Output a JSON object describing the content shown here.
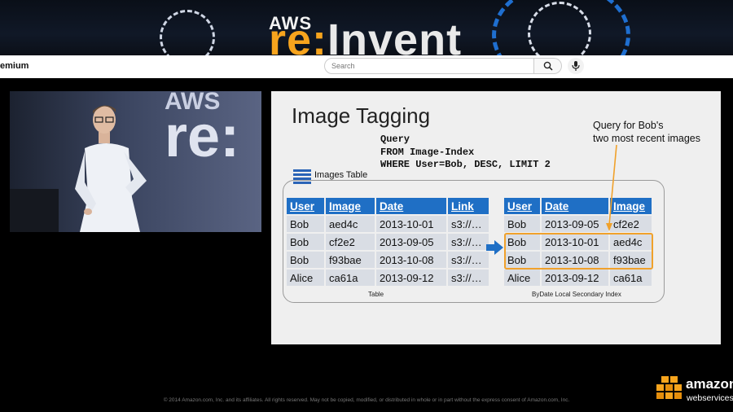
{
  "banner": {
    "brand_aws": "AWS",
    "brand_re": "re:",
    "brand_invent": "Invent",
    "accent": "#f7a41d"
  },
  "youtube": {
    "premium_label": "emium",
    "search_placeholder": "Search",
    "search_icon": "search-icon",
    "mic_icon": "mic-icon"
  },
  "video": {
    "bg_aws": "AWS",
    "bg_re": "re:"
  },
  "slide": {
    "title": "Image Tagging",
    "query_lines": [
      "Query",
      "FROM Image-Index",
      "WHERE User=Bob, DESC, LIMIT 2"
    ],
    "annotation_lines": [
      "Query for Bob's",
      "two most recent images"
    ],
    "images_table_label": "Images Table",
    "table": {
      "headers": [
        "User",
        "Image",
        "Date",
        "Link"
      ],
      "rows": [
        [
          "Bob",
          "aed4c",
          "2013-10-01",
          "s3://…"
        ],
        [
          "Bob",
          "cf2e2",
          "2013-09-05",
          "s3://…"
        ],
        [
          "Bob",
          "f93bae",
          "2013-10-08",
          "s3://…"
        ],
        [
          "Alice",
          "ca61a",
          "2013-09-12",
          "s3://…"
        ]
      ],
      "caption": "Table"
    },
    "index": {
      "headers": [
        "User",
        "Date",
        "Image"
      ],
      "rows": [
        [
          "Bob",
          "2013-09-05",
          "cf2e2"
        ],
        [
          "Bob",
          "2013-10-01",
          "aed4c"
        ],
        [
          "Bob",
          "2013-10-08",
          "f93bae"
        ],
        [
          "Alice",
          "2013-09-12",
          "ca61a"
        ]
      ],
      "caption": "ByDate Local Secondary Index"
    },
    "header_color": "#1f6fc5",
    "highlight_color": "#f0a12b"
  },
  "footer": {
    "copyright": "© 2014 Amazon.com, Inc. and its affiliates. All rights reserved. May not be copied, modified, or distributed in whole or in part without the express consent of Amazon.com, Inc."
  },
  "aws_logo": {
    "amazon": "amazon",
    "web_services": "webservices"
  }
}
